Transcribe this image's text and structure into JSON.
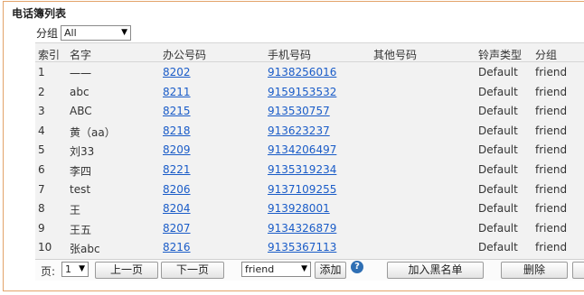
{
  "panel": {
    "title": "电话簿列表"
  },
  "group_filter": {
    "label": "分组",
    "selected": "All"
  },
  "table": {
    "headers": [
      "索引",
      "名字",
      "办公号码",
      "手机号码",
      "其他号码",
      "铃声类型",
      "分组"
    ],
    "rows": [
      {
        "index": "1",
        "name": "一一",
        "office": "8202",
        "mobile": "9138256016",
        "other": "",
        "ring": "Default",
        "group": "friend"
      },
      {
        "index": "2",
        "name": "abc",
        "office": "8211",
        "mobile": "9159153532",
        "other": "",
        "ring": "Default",
        "group": "friend"
      },
      {
        "index": "3",
        "name": "ABC",
        "office": "8215",
        "mobile": "913530757",
        "other": "",
        "ring": "Default",
        "group": "friend"
      },
      {
        "index": "4",
        "name": "黄（aa）",
        "office": "8218",
        "mobile": "913623237",
        "other": "",
        "ring": "Default",
        "group": "friend"
      },
      {
        "index": "5",
        "name": "刘33",
        "office": "8209",
        "mobile": "9134206497",
        "other": "",
        "ring": "Default",
        "group": "friend"
      },
      {
        "index": "6",
        "name": "李四",
        "office": "8221",
        "mobile": "9135319234",
        "other": "",
        "ring": "Default",
        "group": "friend"
      },
      {
        "index": "7",
        "name": "test",
        "office": "8206",
        "mobile": "9137109255",
        "other": "",
        "ring": "Default",
        "group": "friend"
      },
      {
        "index": "8",
        "name": "王",
        "office": "8204",
        "mobile": "913928001",
        "other": "",
        "ring": "Default",
        "group": "friend"
      },
      {
        "index": "9",
        "name": "王五",
        "office": "8207",
        "mobile": "9134326879",
        "other": "",
        "ring": "Default",
        "group": "friend"
      },
      {
        "index": "10",
        "name": "张abc",
        "office": "8216",
        "mobile": "9135367113",
        "other": "",
        "ring": "Default",
        "group": "friend"
      }
    ]
  },
  "footer": {
    "page_label": "页:",
    "page_selected": "1",
    "prev_label": "上一页",
    "next_label": "下一页",
    "target_group_selected": "friend",
    "add_label": "添加",
    "info_icon": "info-icon",
    "blacklist_label": "加入黑名单",
    "delete_label": "删除"
  },
  "colors": {
    "frame_border": "#e3a36a",
    "link": "#1a5cc8",
    "info_icon": "#2f6fb4"
  }
}
